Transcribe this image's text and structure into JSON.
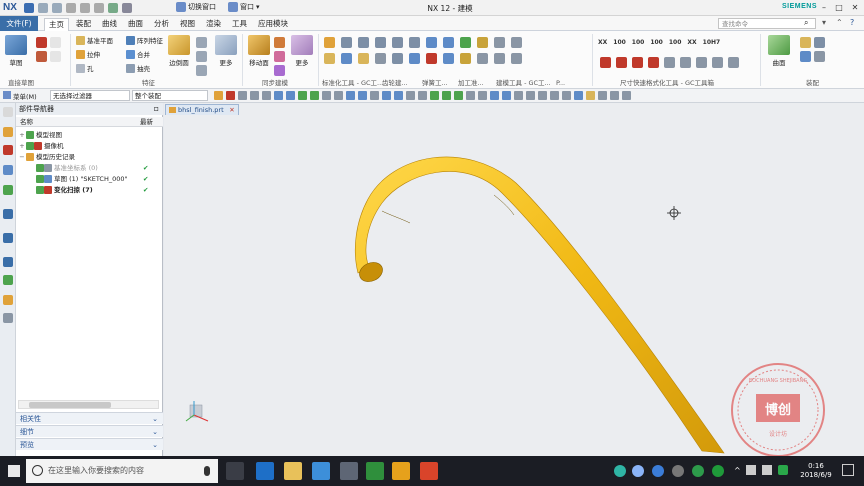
{
  "window": {
    "logo": "NX",
    "title": "NX 12 - 建模",
    "brand": "SIEMENS",
    "switch_window": "切换窗口",
    "window_menu": "窗口",
    "controls": [
      "–",
      "□",
      "✕"
    ]
  },
  "menu_tabs": {
    "file": "文件(F)",
    "tabs": [
      "主页",
      "装配",
      "曲线",
      "曲面",
      "分析",
      "视图",
      "渲染",
      "工具",
      "应用模块"
    ],
    "active": "主页",
    "command_search_placeholder": "查找命令"
  },
  "ribbon": {
    "sketch_btn": "草图",
    "direct_sketch_label": "直接草图",
    "datum_plane": "基准平面",
    "pattern_feature": "阵列特征",
    "extrude": "拉伸",
    "unite": "合并",
    "hole": "孔",
    "shell": "抽壳",
    "edge_blend": "边倒圆",
    "more1": "更多",
    "feature_label": "特征",
    "move_face": "移动面",
    "more2": "更多",
    "sync_label": "同步建模",
    "standard_tools_label": "标准化工具 - GC工...",
    "gear_label": "齿轮建...",
    "spring_label": "弹簧工...",
    "machining_label": "加工准...",
    "build_tools_label": "建模工具 - GC工...",
    "p_label": "P...",
    "dimension_label": "尺寸快速格式化工具 - GC工具箱",
    "surface_btn": "曲面",
    "assembly_label": "装配",
    "dim_numbers": [
      "XX",
      "100",
      "100",
      "100",
      "100",
      "XX",
      "10H7"
    ]
  },
  "filterbar": {
    "menu": "菜单(M)",
    "filter": "无选择过滤器",
    "scope": "整个装配"
  },
  "navigator": {
    "title": "部件导航器",
    "col_name": "名称",
    "col_latest": "最新",
    "rows": [
      {
        "label": "模型视图",
        "toggle": "+",
        "check": ""
      },
      {
        "label": "摄像机",
        "toggle": "+",
        "check": ""
      },
      {
        "label": "模型历史记录",
        "toggle": "−",
        "check": ""
      },
      {
        "label": "基准坐标系 (0)",
        "toggle": "",
        "check": "✔"
      },
      {
        "label": "草图 (1) \"SKETCH_000\"",
        "toggle": "",
        "check": "✔"
      },
      {
        "label": "变化扫掠 (7)",
        "toggle": "",
        "check": "✔"
      }
    ],
    "panels": [
      "相关性",
      "细节",
      "预览"
    ]
  },
  "graphics": {
    "file_tab": "bhsl_finish.prt",
    "tab_close": "✕",
    "watermark_text": "BOCHUANG SHEJIBANG",
    "watermark_center": "博创",
    "watermark_sub": "设计坊",
    "crosshair": "✛"
  },
  "taskbar": {
    "search_placeholder": "在这里输入你要搜索的内容",
    "time": "0:16",
    "date": "2018/6/9"
  }
}
